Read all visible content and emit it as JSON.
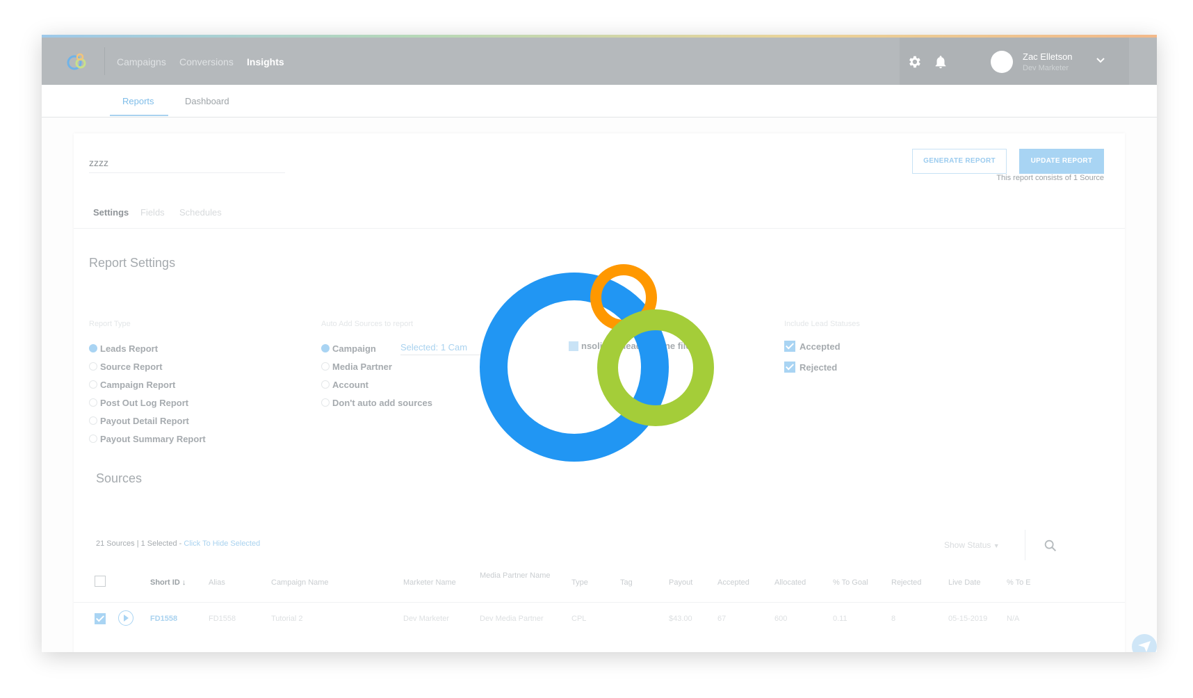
{
  "colors": {
    "accent": "#2196f3",
    "spinner_blue": "#2196f3",
    "spinner_orange": "#ff9800",
    "spinner_green": "#a4cd39",
    "topbar": "#b5b9bc"
  },
  "topbar": {
    "nav": [
      "Campaigns",
      "Conversions",
      "Insights"
    ],
    "active_nav": "Insights",
    "icons": [
      "logo-icon",
      "gear-icon",
      "bell-icon",
      "chevron-down-icon"
    ],
    "user_name": "Zac Elletson",
    "user_role": "Dev Marketer"
  },
  "subnav": {
    "tabs": [
      "Reports",
      "Dashboard"
    ],
    "active": "Reports"
  },
  "report": {
    "name": "zzzz",
    "generate_label": "GENERATE REPORT",
    "update_label": "UPDATE REPORT",
    "note": "This report consists of 1 Source",
    "tabs": [
      "Settings",
      "Fields",
      "Schedules"
    ],
    "active_tab": "Settings"
  },
  "settings": {
    "title": "Report Settings",
    "report_type_label": "Report Type",
    "report_types": [
      "Leads Report",
      "Source Report",
      "Campaign Report",
      "Post Out Log Report",
      "Payout Detail Report",
      "Payout Summary Report"
    ],
    "selected_report_type": "Leads Report",
    "auto_add_label": "Auto Add Sources to report",
    "auto_add_options": [
      "Campaign",
      "Media Partner",
      "Account",
      "Don't auto add sources"
    ],
    "selected_auto_add": "Campaign",
    "campaign_select_value": "Selected: 1 Cam",
    "consolidate_visible_left": "nsolidate lead",
    "consolidate_visible_right": "one file",
    "lead_status_label": "Include Lead Statuses",
    "lead_statuses": [
      "Accepted",
      "Rejected"
    ]
  },
  "sources": {
    "title": "Sources",
    "summary": "21 Sources  | 1 Selected - ",
    "toggle_link": "Click To Hide Selected",
    "show_status": "Show Status",
    "columns": [
      "Short ID",
      "Alias",
      "Campaign Name",
      "Marketer Name",
      "Media Partner Name",
      "Type",
      "Tag",
      "Payout",
      "Accepted",
      "Allocated",
      "% To Goal",
      "Rejected",
      "Live Date",
      "% To Er"
    ],
    "row": [
      "FD1558",
      "FD1558",
      "Tutorial 2",
      "Dev Marketer",
      "Dev Media Partner",
      "CPL",
      "",
      "$43.00",
      "67",
      "600",
      "0.11",
      "8",
      "05-15-2019",
      "N/A"
    ]
  }
}
